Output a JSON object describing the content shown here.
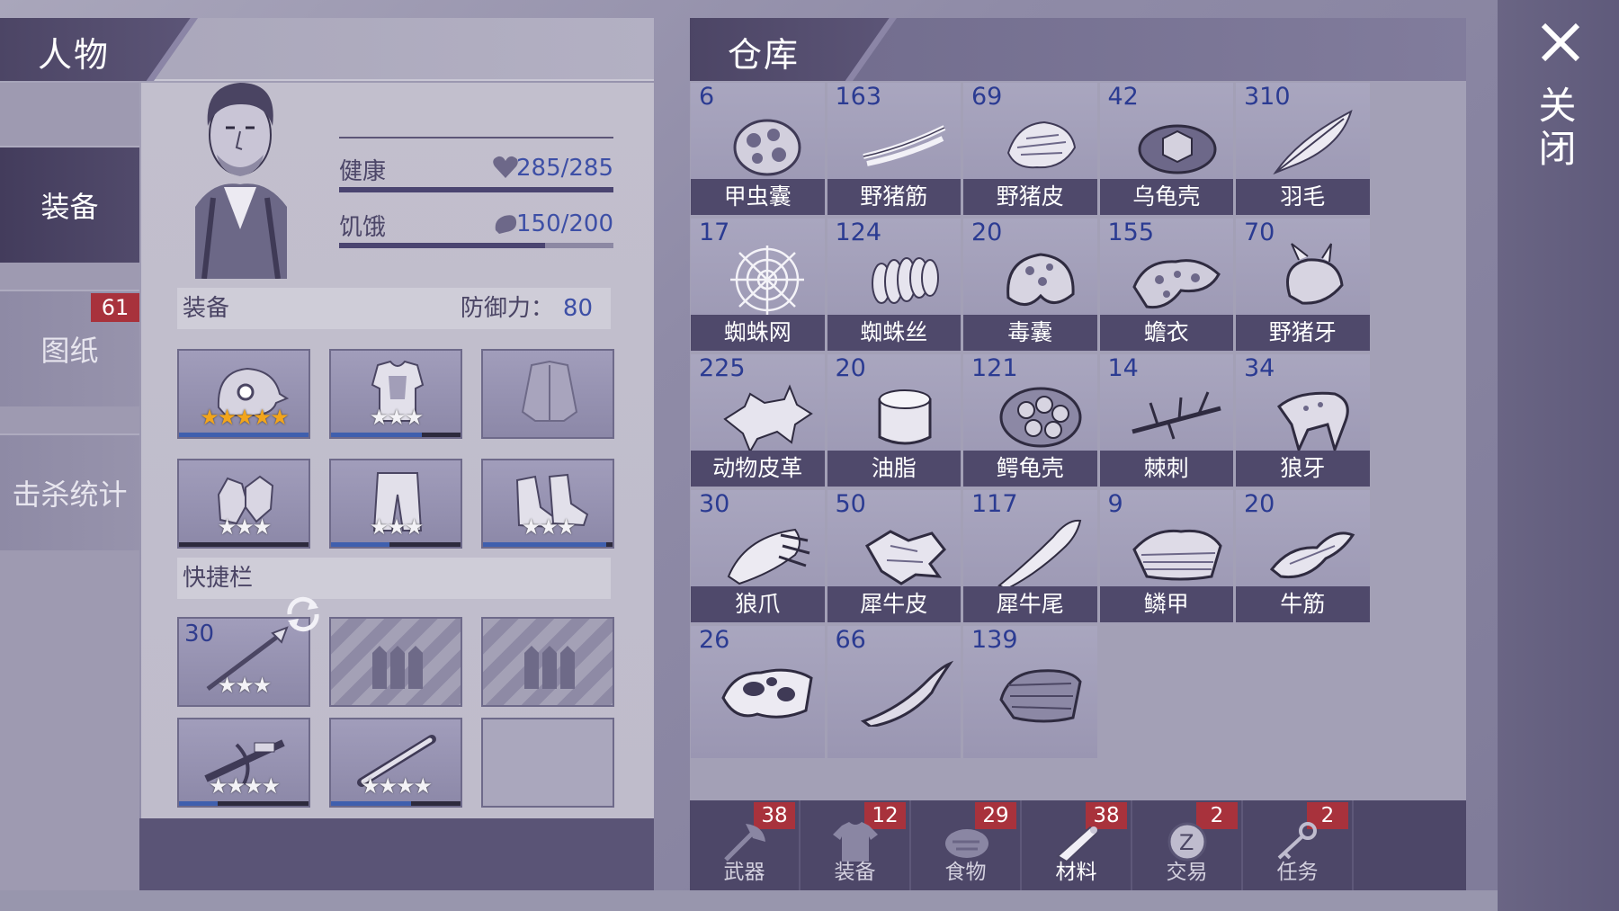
{
  "character": {
    "title": "人物",
    "nav": [
      {
        "label": "装备",
        "badge": ""
      },
      {
        "label": "图纸",
        "badge": "61"
      },
      {
        "label": "击杀统计",
        "badge": ""
      }
    ],
    "stats": {
      "health": {
        "label": "健康",
        "value": "285/285",
        "fraction": 1.0
      },
      "hunger": {
        "label": "饥饿",
        "value": "150/200",
        "fraction": 0.75
      }
    },
    "equipment": {
      "label": "装备",
      "defense_label": "防御力：",
      "defense_value": "80",
      "slots": [
        {
          "icon": "helmet-icon",
          "stars": "★★★★★",
          "gold": true,
          "durability": 1.0
        },
        {
          "icon": "vest-icon",
          "stars": "★★★",
          "gold": false,
          "durability": 0.7
        },
        {
          "icon": "jacket-icon",
          "stars": "",
          "gold": false,
          "durability": null
        },
        {
          "icon": "gloves-icon",
          "stars": "★★★",
          "gold": false,
          "durability": 0.0
        },
        {
          "icon": "pants-icon",
          "stars": "★★★",
          "gold": false,
          "durability": 0.45
        },
        {
          "icon": "boots-icon",
          "stars": "★★★",
          "gold": false,
          "durability": 0.95
        }
      ]
    },
    "quickbar": {
      "label": "快捷栏",
      "slots": [
        {
          "icon": "spear-icon",
          "count": "30",
          "stars": "★★★"
        },
        {
          "icon": "locked-slot",
          "count": "",
          "stars": ""
        },
        {
          "icon": "locked-slot",
          "count": "",
          "stars": ""
        },
        {
          "icon": "crossbow-icon",
          "count": "",
          "stars": "★★★★"
        },
        {
          "icon": "baton-icon",
          "count": "",
          "stars": "★★★★"
        },
        {
          "icon": "empty-slot",
          "count": "",
          "stars": ""
        }
      ]
    }
  },
  "warehouse": {
    "title": "仓库",
    "items": [
      {
        "count": "6",
        "name": "甲虫囊",
        "icon": "beetle-sac-icon"
      },
      {
        "count": "163",
        "name": "野猪筋",
        "icon": "boar-tendon-icon"
      },
      {
        "count": "69",
        "name": "野猪皮",
        "icon": "boar-hide-icon"
      },
      {
        "count": "42",
        "name": "乌龟壳",
        "icon": "turtle-shell-icon"
      },
      {
        "count": "310",
        "name": "羽毛",
        "icon": "feather-icon"
      },
      {
        "count": "17",
        "name": "蜘蛛网",
        "icon": "spider-web-icon"
      },
      {
        "count": "124",
        "name": "蜘蛛丝",
        "icon": "spider-silk-icon"
      },
      {
        "count": "20",
        "name": "毒囊",
        "icon": "poison-sac-icon"
      },
      {
        "count": "155",
        "name": "蟾衣",
        "icon": "toad-skin-icon"
      },
      {
        "count": "70",
        "name": "野猪牙",
        "icon": "boar-tusk-icon"
      },
      {
        "count": "225",
        "name": "动物皮革",
        "icon": "leather-icon"
      },
      {
        "count": "20",
        "name": "油脂",
        "icon": "grease-icon"
      },
      {
        "count": "121",
        "name": "鳄龟壳",
        "icon": "snapping-turtle-shell-icon"
      },
      {
        "count": "14",
        "name": "棘刺",
        "icon": "thorn-icon"
      },
      {
        "count": "34",
        "name": "狼牙",
        "icon": "wolf-fang-icon"
      },
      {
        "count": "30",
        "name": "狼爪",
        "icon": "wolf-claw-icon"
      },
      {
        "count": "50",
        "name": "犀牛皮",
        "icon": "rhino-hide-icon"
      },
      {
        "count": "117",
        "name": "犀牛尾",
        "icon": "rhino-tail-icon"
      },
      {
        "count": "9",
        "name": "鳞甲",
        "icon": "scale-armor-icon"
      },
      {
        "count": "20",
        "name": "牛筋",
        "icon": "ox-tendon-icon"
      },
      {
        "count": "26",
        "name": "",
        "icon": "cow-hide-icon"
      },
      {
        "count": "66",
        "name": "",
        "icon": "horn-icon"
      },
      {
        "count": "139",
        "name": "",
        "icon": "fur-icon"
      }
    ],
    "tabs": [
      {
        "label": "武器",
        "badge": "38",
        "icon": "axe-icon"
      },
      {
        "label": "装备",
        "badge": "12",
        "icon": "shirt-icon"
      },
      {
        "label": "食物",
        "badge": "29",
        "icon": "meat-icon"
      },
      {
        "label": "材料",
        "badge": "38",
        "icon": "wood-icon",
        "active": true
      },
      {
        "label": "交易",
        "badge": "2",
        "icon": "coin-icon"
      },
      {
        "label": "任务",
        "badge": "2",
        "icon": "key-icon"
      }
    ]
  },
  "close": {
    "label": "关闭"
  }
}
